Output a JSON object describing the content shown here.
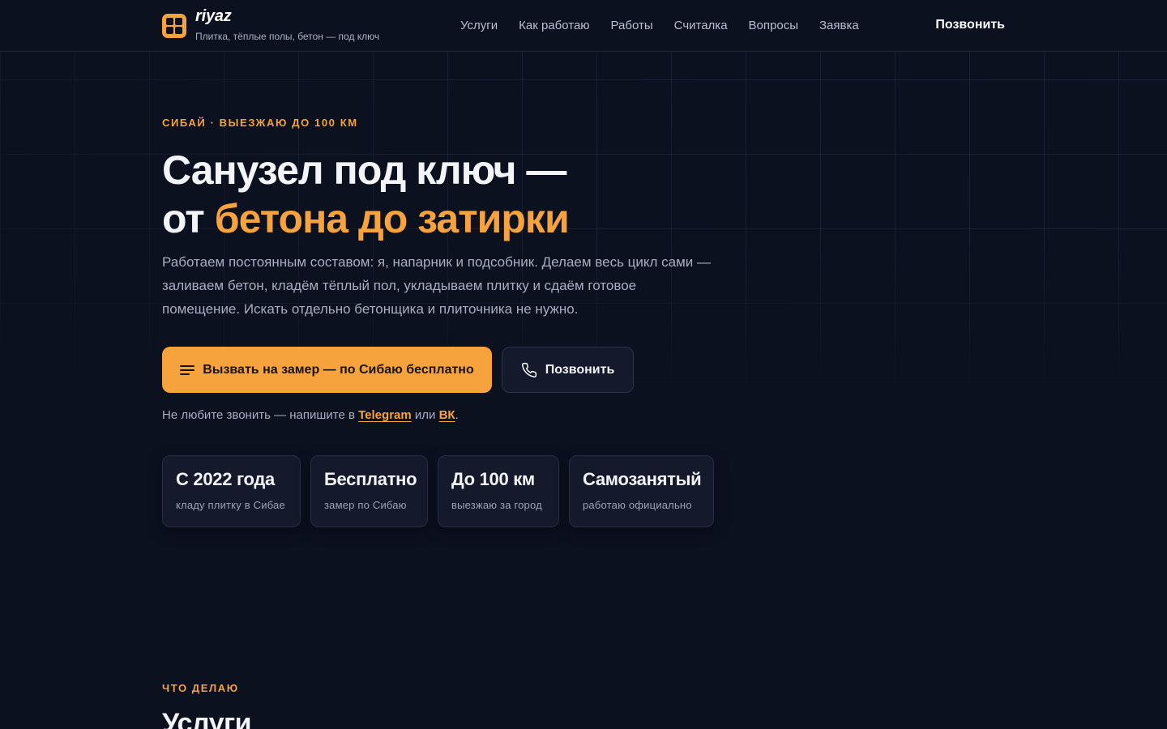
{
  "header": {
    "brand": "riyaz",
    "tagline": "Плитка, тёплые полы, бетон — под ключ",
    "nav": [
      {
        "label": "Услуги"
      },
      {
        "label": "Как работаю"
      },
      {
        "label": "Работы"
      },
      {
        "label": "Считалка"
      },
      {
        "label": "Вопросы"
      },
      {
        "label": "Заявка"
      }
    ],
    "call_label": "Позвонить",
    "logo_icon": "grid-logo-icon"
  },
  "hero": {
    "eyebrow": "Сибай · выезжаю до 100 км",
    "title_line1": "Санузел под ключ —",
    "title_line2_prefix": "от ",
    "title_line2_accent": "бетона до затирки",
    "lead": "Работаем постоянным составом: я, напарник и подсобник. Делаем весь цикл сами — заливаем бетон, кладём тёплый пол, укладываем плитку и сдаём готовое помещение. Искать отдельно бетонщика и плиточника не нужно.",
    "primary_button": "Вызвать на замер — по Сибаю бесплатно",
    "primary_button_icon": "menu-lines-icon",
    "secondary_button": "Позвонить",
    "secondary_button_icon": "phone-icon",
    "note_prefix": "Не любите звонить — напишите в ",
    "note_link1": "Telegram",
    "note_mid": " или ",
    "note_link2": "ВК",
    "note_suffix": "."
  },
  "stats": [
    {
      "value": "С 2022 года",
      "label": "кладу плитку в Сибае"
    },
    {
      "value": "Бесплатно",
      "label": "замер по Сибаю"
    },
    {
      "value": "До 100 км",
      "label": "выезжаю за город"
    },
    {
      "value": "Самозанятый",
      "label": "работаю официально"
    }
  ],
  "services": {
    "eyebrow": "Что делаю",
    "title": "Услуги"
  },
  "colors": {
    "background": "#0c1120",
    "accent": "#f6a23d",
    "card": "#141a2c",
    "text": "#f2f4f8",
    "muted": "#a7aec0"
  }
}
